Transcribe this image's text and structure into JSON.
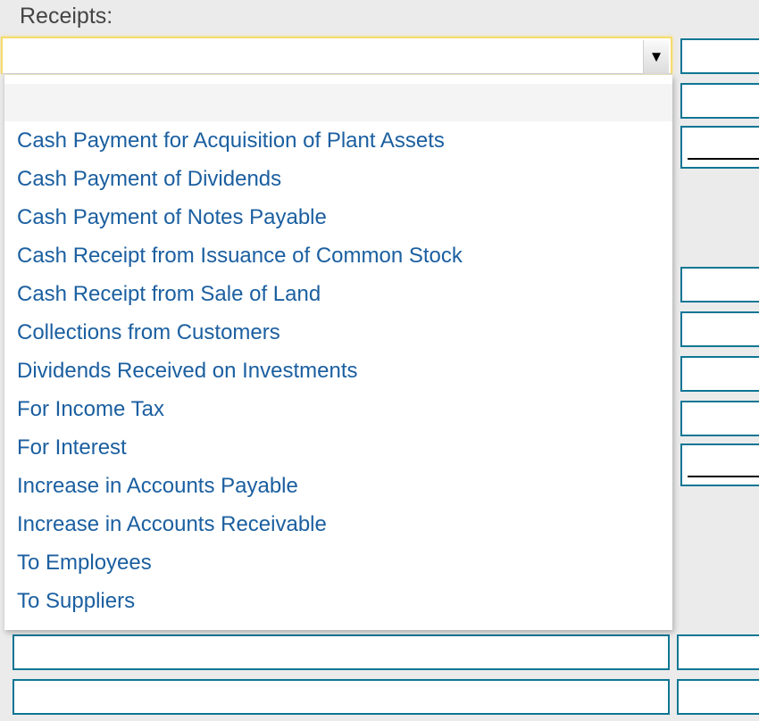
{
  "section": {
    "label": "Receipts:"
  },
  "select": {
    "value": "",
    "arrow_icon": "triangle-down"
  },
  "dropdown": {
    "options": [
      "",
      "Cash Payment for Acquisition of Plant Assets",
      "Cash Payment of Dividends",
      "Cash Payment of Notes Payable",
      "Cash Receipt from Issuance of Common Stock",
      "Cash Receipt from Sale of Land",
      "Collections from Customers",
      "Dividends Received on Investments",
      "For Income Tax",
      "For Interest",
      "Increase in Accounts Payable",
      "Increase in Accounts Receivable",
      "To Employees",
      "To Suppliers"
    ]
  },
  "amount_fields": [
    "",
    "",
    "",
    "",
    "",
    "",
    "",
    "",
    "",
    "",
    ""
  ],
  "description_fields": [
    "",
    ""
  ],
  "colors": {
    "field_border": "#0e7694",
    "option_text": "#1b5fa0",
    "focus_border": "#f6dc6a"
  }
}
